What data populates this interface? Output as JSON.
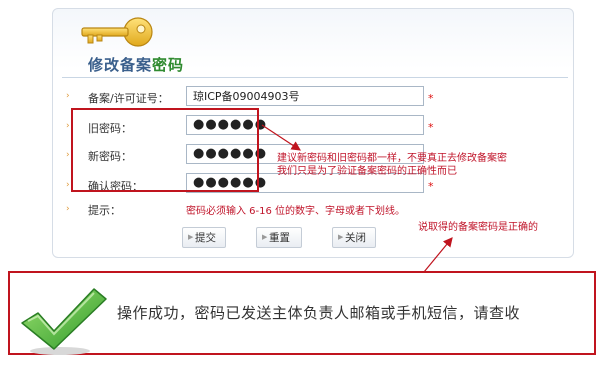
{
  "form": {
    "title_main": "修改备案",
    "title_accent": "密码",
    "icp_label": "备案/许可证号：",
    "icp_value": "琼ICP备09004903号",
    "old_pw_label": "旧密码：",
    "old_pw_value": "●●●●●●",
    "new_pw_label": "新密码：",
    "new_pw_value": "●●●●●●",
    "confirm_pw_label": "确认密码：",
    "confirm_pw_value": "●●●●●●",
    "required_mark": "*",
    "tip_label": "提示：",
    "tip_text": "密码必须输入 6-16 位的数字、字母或者下划线。",
    "submit_label": "提交",
    "reset_label": "重置",
    "close_label": "关闭",
    "bullet": "›"
  },
  "annotations": {
    "note_line1": "建议新密码和旧密码都一样，不要真正去修改备案密",
    "note_line2": "我们只是为了验证备案密码的正确性而已",
    "note_correct": "说取得的备案密码是正确的"
  },
  "success": {
    "message": "操作成功，密码已发送主体负责人邮箱或手机短信，请查收"
  },
  "colors": {
    "annotation_red": "#c0141e",
    "title_blue": "#3a5f8c",
    "title_green": "#2f8a2f",
    "check_green": "#4cb33c"
  }
}
